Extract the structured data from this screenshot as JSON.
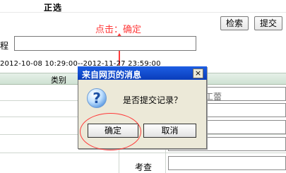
{
  "header": {
    "title": "正选"
  },
  "toolbar": {
    "search_label": "检索",
    "submit_label": "提交"
  },
  "annotation": {
    "text": "点击：确定"
  },
  "form": {
    "course_label": "程",
    "course_value": ""
  },
  "date_range": "2012-10-08 10:29:00--2012-11-27 23:59:00",
  "table": {
    "category_header": "类别",
    "name_partial": "工蕾",
    "exam_label": "考查"
  },
  "dialog": {
    "title": "来自网页的消息",
    "close_symbol": "×",
    "message": "是否提交记录？",
    "icon": "question-icon",
    "ok_label": "确定",
    "cancel_label": "取消"
  },
  "colors": {
    "annotation": "#ff3a3a",
    "titlebar": "#0a3dbb",
    "dialog_bg": "#ece9d8"
  }
}
